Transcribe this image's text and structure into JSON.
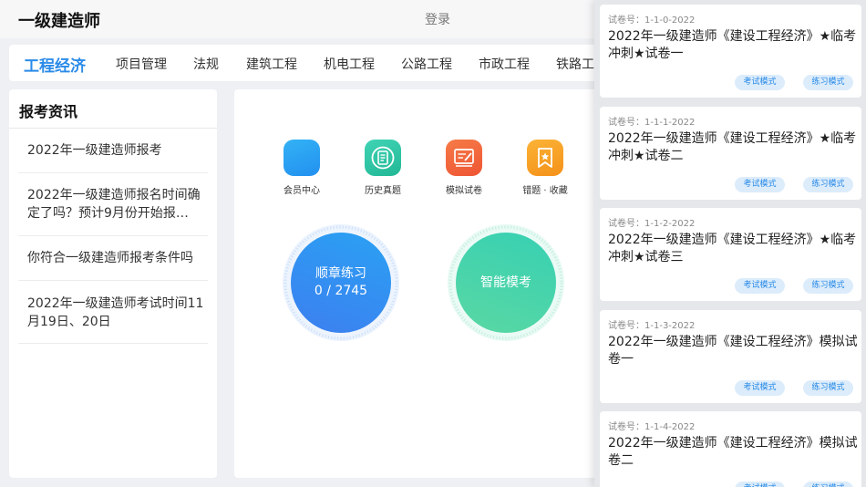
{
  "header": {
    "app_title": "一级建造师",
    "login_label": "登录"
  },
  "tabs": [
    {
      "label": "工程经济",
      "active": true
    },
    {
      "label": "项目管理"
    },
    {
      "label": "法规"
    },
    {
      "label": "建筑工程"
    },
    {
      "label": "机电工程"
    },
    {
      "label": "公路工程"
    },
    {
      "label": "市政工程"
    },
    {
      "label": "铁路工"
    }
  ],
  "news": {
    "title": "报考资讯",
    "items": [
      "2022年一级建造师报考",
      "2022年一级建造师报名时间确定了吗？预计9月份开始报…",
      "你符合一级建造师报考条件吗",
      "2022年一级建造师考试时间11月19日、20日"
    ]
  },
  "quick": [
    {
      "label": "会员中心",
      "icon": "member-icon",
      "color": "#2aa1f3"
    },
    {
      "label": "历史真题",
      "icon": "history-exam-icon",
      "color": "#29c4a3"
    },
    {
      "label": "模拟试卷",
      "icon": "mock-paper-icon",
      "color": "#f2663c"
    },
    {
      "label": "错题 · 收藏",
      "icon": "bookmark-icon",
      "color": "#f7a024"
    }
  ],
  "practice": {
    "label": "顺章练习",
    "progress": "0 / 2745"
  },
  "smart": {
    "label": "智能模考"
  },
  "papers": {
    "exam_mode_label": "考试模式",
    "practice_mode_label": "练习模式",
    "items": [
      {
        "no": "试卷号：1-1-0-2022",
        "title": "2022年一级建造师《建设工程经济》★临考冲刺★试卷一"
      },
      {
        "no": "试卷号：1-1-1-2022",
        "title": "2022年一级建造师《建设工程经济》★临考冲刺★试卷二"
      },
      {
        "no": "试卷号：1-1-2-2022",
        "title": "2022年一级建造师《建设工程经济》★临考冲刺★试卷三"
      },
      {
        "no": "试卷号：1-1-3-2022",
        "title": "2022年一级建造师《建设工程经济》模拟试卷一"
      },
      {
        "no": "试卷号：1-1-4-2022",
        "title": "2022年一级建造师《建设工程经济》模拟试卷二"
      }
    ]
  },
  "colors": {
    "accent": "#2a8be8",
    "practice_gradient": [
      "#2aa1f3",
      "#3d7ff0"
    ],
    "smart_gradient": [
      "#37d0b3",
      "#5ad8a3"
    ]
  }
}
